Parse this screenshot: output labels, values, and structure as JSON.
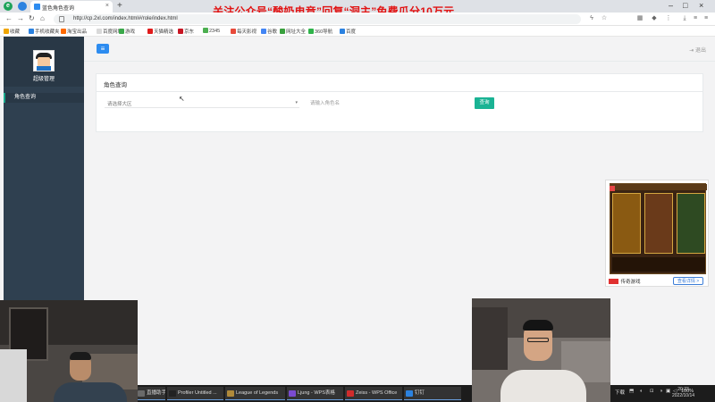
{
  "browser": {
    "tab_title": "蓝色角色查询",
    "new_tab": "+",
    "url": "http://cp.2xl.com/index.html#/role/index.html",
    "nav": {
      "back": "←",
      "forward": "→",
      "reload": "↻",
      "home": "⌂"
    }
  },
  "banner_text": "关注公众号“酸奶电竞”回复“洞主”免费瓜分10万元",
  "bookmarks": [
    {
      "label": "收藏",
      "color": "#f0a500"
    },
    {
      "label": "手机收藏夹",
      "color": "#2b82e0"
    },
    {
      "label": "淘宝出品",
      "color": "#ff6a00"
    },
    {
      "label": "百度网址",
      "color": "#d9d9d9"
    },
    {
      "label": "游戏",
      "color": "#3aa84a"
    },
    {
      "label": "天猫精选",
      "color": "#e01b1b"
    },
    {
      "label": "京东",
      "color": "#c81623"
    },
    {
      "label": "2345",
      "color": "#4caf50"
    },
    {
      "label": "每天影视",
      "color": "#e84a3a"
    },
    {
      "label": "谷歌",
      "color": "#4285f4"
    },
    {
      "label": "网址大全",
      "color": "#39a03d"
    },
    {
      "label": "360导航",
      "color": "#2fb34a"
    },
    {
      "label": "百度",
      "color": "#2b82e0"
    }
  ],
  "sidebar": {
    "username": "超级管理",
    "menu": [
      {
        "label": "角色查询"
      }
    ]
  },
  "topbar": {
    "menu_icon": "≡",
    "logout": "退出"
  },
  "panel": {
    "title": "角色查询",
    "select": {
      "selected": "请选择大区",
      "arrow": "▾"
    },
    "role_input": {
      "placeholder": "请输入角色名"
    },
    "query_button": "查询"
  },
  "ad": {
    "brand": "传奇游戏",
    "cta": "查看详情 >"
  },
  "taskbar": {
    "tasks": [
      {
        "label": "直播助手 - ...",
        "color": "#6a6a6a"
      },
      {
        "label": "Profiler Untitled ...",
        "color": "#222"
      },
      {
        "label": "League of Legends",
        "color": "#b08a3a"
      },
      {
        "label": "Ljung - WPS表格",
        "color": "#7a4bd0"
      },
      {
        "label": "Zeiss - WPS Office",
        "color": "#d02c2c"
      },
      {
        "label": "钉钉",
        "color": "#2b82e0"
      }
    ],
    "tray": [
      "下载",
      "⬒",
      "◐",
      "⊡",
      "◑",
      "▣",
      "◁",
      "100%"
    ],
    "time": "20:23",
    "date": "2022/10/14"
  },
  "colors": {
    "sidebar": "#2f4050",
    "accent": "#1ab394",
    "primary": "#2d8cf0",
    "banner": "#e11212"
  }
}
